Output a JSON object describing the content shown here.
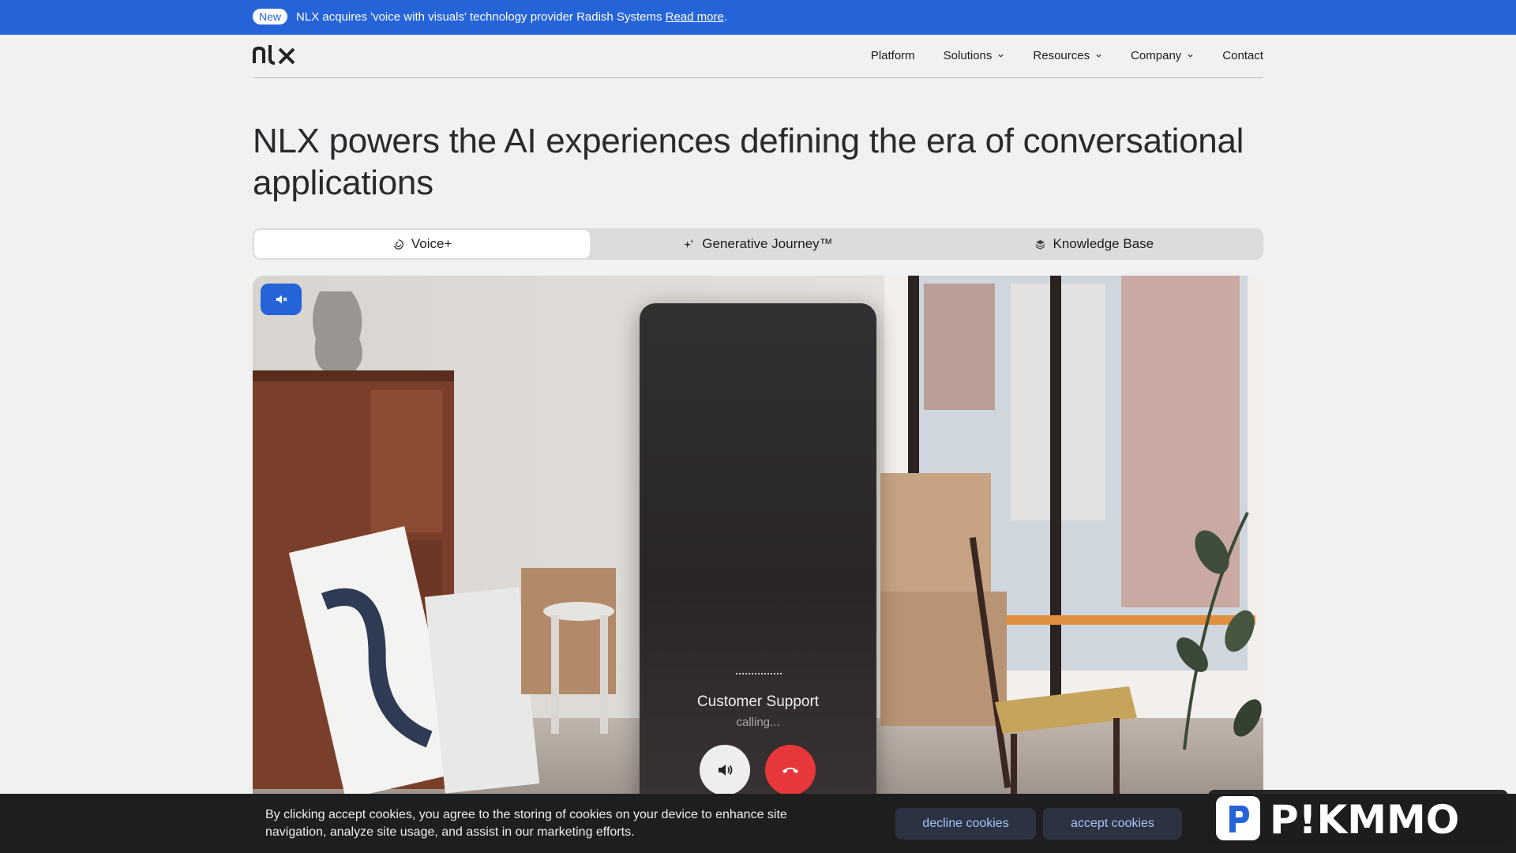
{
  "announcement": {
    "badge": "New",
    "text": "NLX acquires 'voice with visuals' technology provider Radish Systems",
    "link": "Read more",
    "trailing": "."
  },
  "nav": {
    "logo_alt": "nlx",
    "items": [
      {
        "label": "Platform",
        "has_dropdown": false
      },
      {
        "label": "Solutions",
        "has_dropdown": true
      },
      {
        "label": "Resources",
        "has_dropdown": true
      },
      {
        "label": "Company",
        "has_dropdown": true
      },
      {
        "label": "Contact",
        "has_dropdown": false
      }
    ]
  },
  "hero": {
    "title": "NLX powers the AI experiences defining the era of conversational applications"
  },
  "tabs": [
    {
      "label": "Voice+",
      "icon": "voice-plus-icon",
      "active": true
    },
    {
      "label": "Generative Journey™",
      "icon": "sparkle-icon",
      "active": false
    },
    {
      "label": "Knowledge Base",
      "icon": "layers-icon",
      "active": false
    }
  ],
  "demo": {
    "caller": "Customer Support",
    "status": "calling..."
  },
  "cookie": {
    "text": "By clicking accept cookies, you agree to the storing of cookies on your device to enhance site navigation, analyze site usage, and assist in our marketing efforts.",
    "decline": "decline cookies",
    "accept": "accept cookies"
  },
  "watermark": "P!KMMO",
  "colors": {
    "brand_blue": "#2563d9",
    "hangup_red": "#e8373a",
    "cookie_bg": "#1e1e1f"
  }
}
